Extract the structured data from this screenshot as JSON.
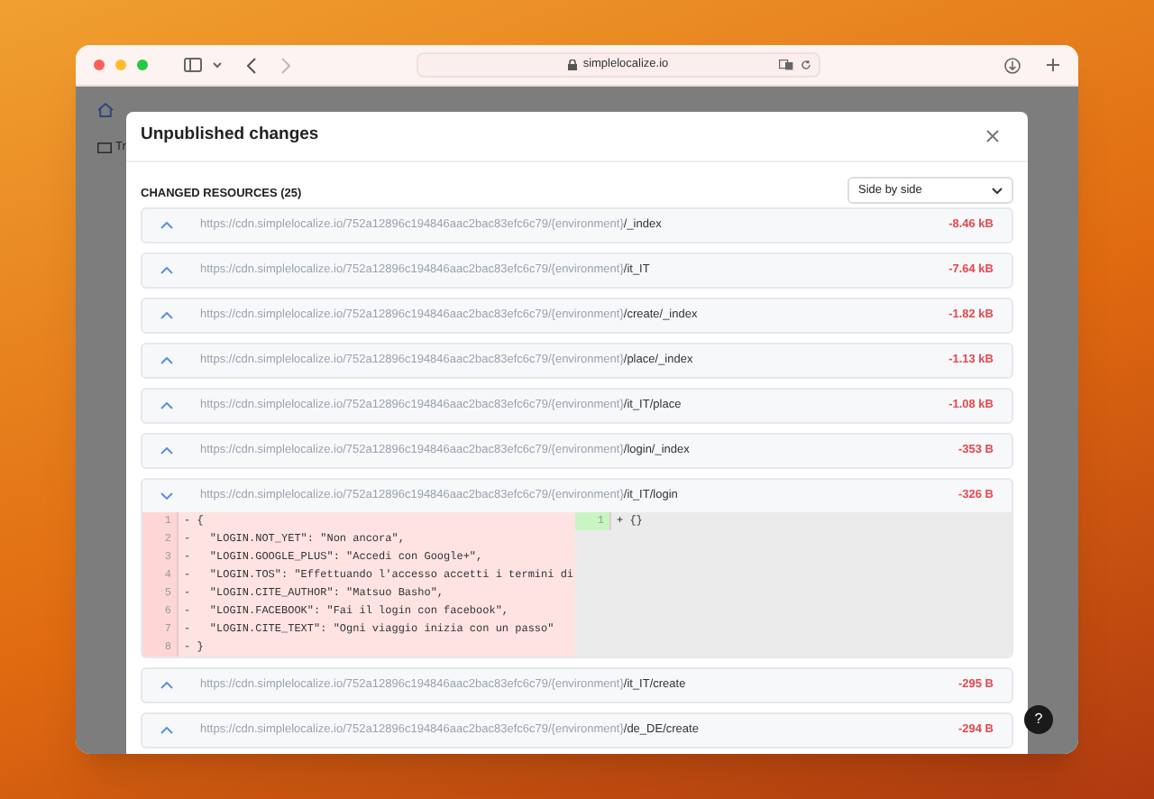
{
  "browser": {
    "url": "simplelocalize.io"
  },
  "background": {
    "tab_label": "Tr"
  },
  "modal": {
    "title": "Unpublished changes",
    "section_label": "CHANGED RESOURCES (25)",
    "view_select": {
      "value": "Side by side"
    },
    "resources": [
      {
        "prefix": "https://cdn.simplelocalize.io/752a12896c194846aac2bac83efc6c79/{environment}",
        "path": "/_index",
        "size": "-8.46 kB",
        "expanded": false
      },
      {
        "prefix": "https://cdn.simplelocalize.io/752a12896c194846aac2bac83efc6c79/{environment}",
        "path": "/it_IT",
        "size": "-7.64 kB",
        "expanded": false
      },
      {
        "prefix": "https://cdn.simplelocalize.io/752a12896c194846aac2bac83efc6c79/{environment}",
        "path": "/create/_index",
        "size": "-1.82 kB",
        "expanded": false
      },
      {
        "prefix": "https://cdn.simplelocalize.io/752a12896c194846aac2bac83efc6c79/{environment}",
        "path": "/place/_index",
        "size": "-1.13 kB",
        "expanded": false
      },
      {
        "prefix": "https://cdn.simplelocalize.io/752a12896c194846aac2bac83efc6c79/{environment}",
        "path": "/it_IT/place",
        "size": "-1.08 kB",
        "expanded": false
      },
      {
        "prefix": "https://cdn.simplelocalize.io/752a12896c194846aac2bac83efc6c79/{environment}",
        "path": "/login/_index",
        "size": "-353 B",
        "expanded": false
      },
      {
        "prefix": "https://cdn.simplelocalize.io/752a12896c194846aac2bac83efc6c79/{environment}",
        "path": "/it_IT/login",
        "size": "-326 B",
        "expanded": true,
        "diff": {
          "left": [
            {
              "number": "1",
              "sign": "-",
              "text": "{"
            },
            {
              "number": "2",
              "sign": "-",
              "text": "  \"LOGIN.NOT_YET\": \"Non ancora\","
            },
            {
              "number": "3",
              "sign": "-",
              "text": "  \"LOGIN.GOOGLE_PLUS\": \"Accedi con Google+\","
            },
            {
              "number": "4",
              "sign": "-",
              "text": "  \"LOGIN.TOS\": \"Effettuando l'accesso accetti i termini di"
            },
            {
              "number": "5",
              "sign": "-",
              "text": "  \"LOGIN.CITE_AUTHOR\": \"Matsuo Basho\","
            },
            {
              "number": "6",
              "sign": "-",
              "text": "  \"LOGIN.FACEBOOK\": \"Fai il login con facebook\","
            },
            {
              "number": "7",
              "sign": "-",
              "text": "  \"LOGIN.CITE_TEXT\": \"Ogni viaggio inizia con un passo\""
            },
            {
              "number": "8",
              "sign": "-",
              "text": "}"
            }
          ],
          "right": [
            {
              "number": "1",
              "sign": "+",
              "text": "{}"
            }
          ]
        }
      },
      {
        "prefix": "https://cdn.simplelocalize.io/752a12896c194846aac2bac83efc6c79/{environment}",
        "path": "/it_IT/create",
        "size": "-295 B",
        "expanded": false
      },
      {
        "prefix": "https://cdn.simplelocalize.io/752a12896c194846aac2bac83efc6c79/{environment}",
        "path": "/de_DE/create",
        "size": "-294 B",
        "expanded": false
      }
    ]
  },
  "help_button": {
    "label": "?"
  }
}
